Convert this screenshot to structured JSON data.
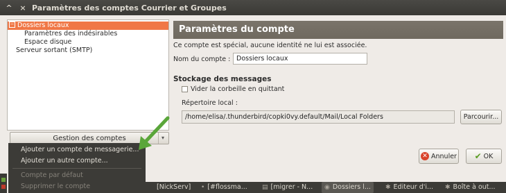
{
  "window": {
    "title": "Paramètres des comptes Courrier et Groupes",
    "controls": [
      "^",
      "×"
    ]
  },
  "tree": {
    "items": [
      {
        "label": "Dossiers locaux",
        "selected": true,
        "expander": "−"
      },
      {
        "label": "Paramètres des indésirables"
      },
      {
        "label": "Espace disque"
      },
      {
        "label": "Serveur sortant (SMTP)"
      }
    ]
  },
  "account_actions": {
    "label": "Gestion des comptes",
    "arrow": "▾"
  },
  "menu": {
    "items": [
      {
        "label": "Ajouter un compte de messagerie...",
        "enabled": true
      },
      {
        "label": "Ajouter un autre compte...",
        "enabled": true
      },
      {
        "label": "Compte par défaut",
        "enabled": false
      },
      {
        "label": "Supprimer le compte",
        "enabled": false
      }
    ]
  },
  "panel": {
    "title": "Paramètres du compte",
    "notice": "Ce compte est spécial, aucune identité ne lui est associée.",
    "account_name_label": "Nom du compte :",
    "account_name_value": "Dossiers locaux",
    "storage_heading": "Stockage des messages",
    "empty_trash_label": "Vider la corbeille en quittant",
    "empty_trash_checked": false,
    "local_dir_label": "Répertoire local :",
    "local_dir_value": "/home/elisa/.thunderbird/copki0vy.default/Mail/Local Folders",
    "browse_label": "Parcourir..."
  },
  "dialog_buttons": {
    "cancel_label": "Annuler",
    "ok_label": "OK"
  },
  "taskbar": {
    "tasks": [
      {
        "label": "[NickServ]",
        "icon": ""
      },
      {
        "label": "[#flossma...",
        "icon": "•"
      },
      {
        "label": "[migrer - N...",
        "icon": "▤"
      },
      {
        "label": "Dossiers l...",
        "icon": "◉",
        "active": true
      },
      {
        "label": "Editeur d'i...",
        "icon": "✱"
      },
      {
        "label": "Boîte à out...",
        "icon": "✱"
      }
    ]
  },
  "colors": {
    "selection": "#f07746",
    "header": "#736d63",
    "menu_bg": "#3c3b37",
    "annotation_arrow": "#5aa63a"
  }
}
